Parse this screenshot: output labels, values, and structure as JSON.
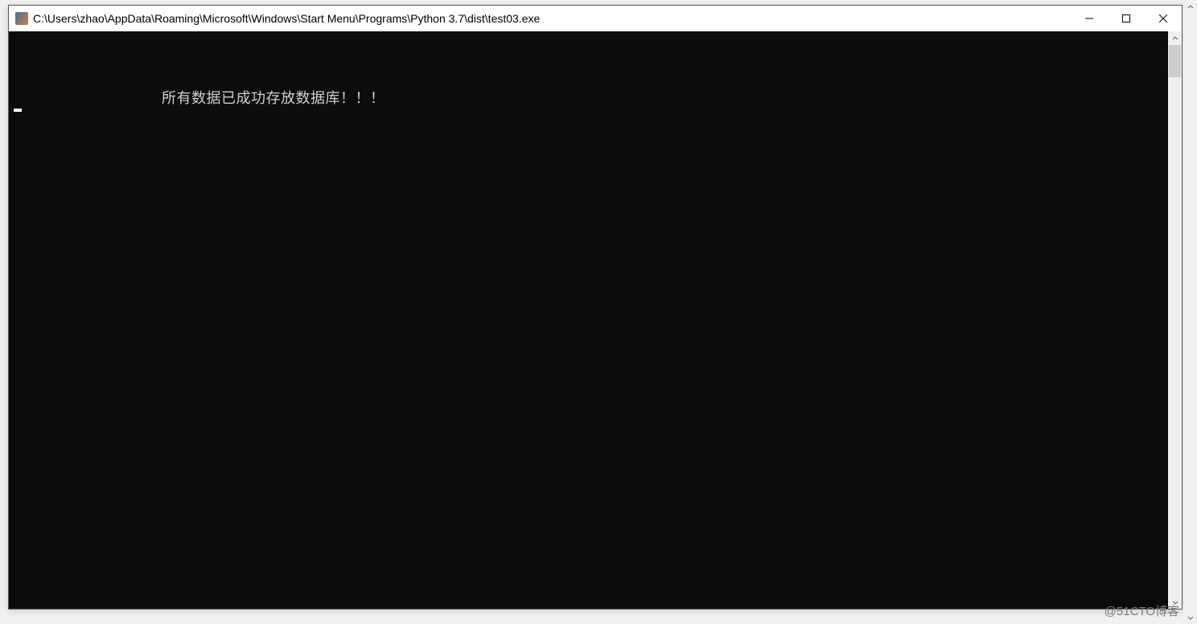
{
  "window": {
    "title": "C:\\Users\\zhao\\AppData\\Roaming\\Microsoft\\Windows\\Start Menu\\Programs\\Python 3.7\\dist\\test03.exe"
  },
  "console": {
    "message": "所有数据已成功存放数据库！！！"
  },
  "watermark": "@51CTO博客"
}
